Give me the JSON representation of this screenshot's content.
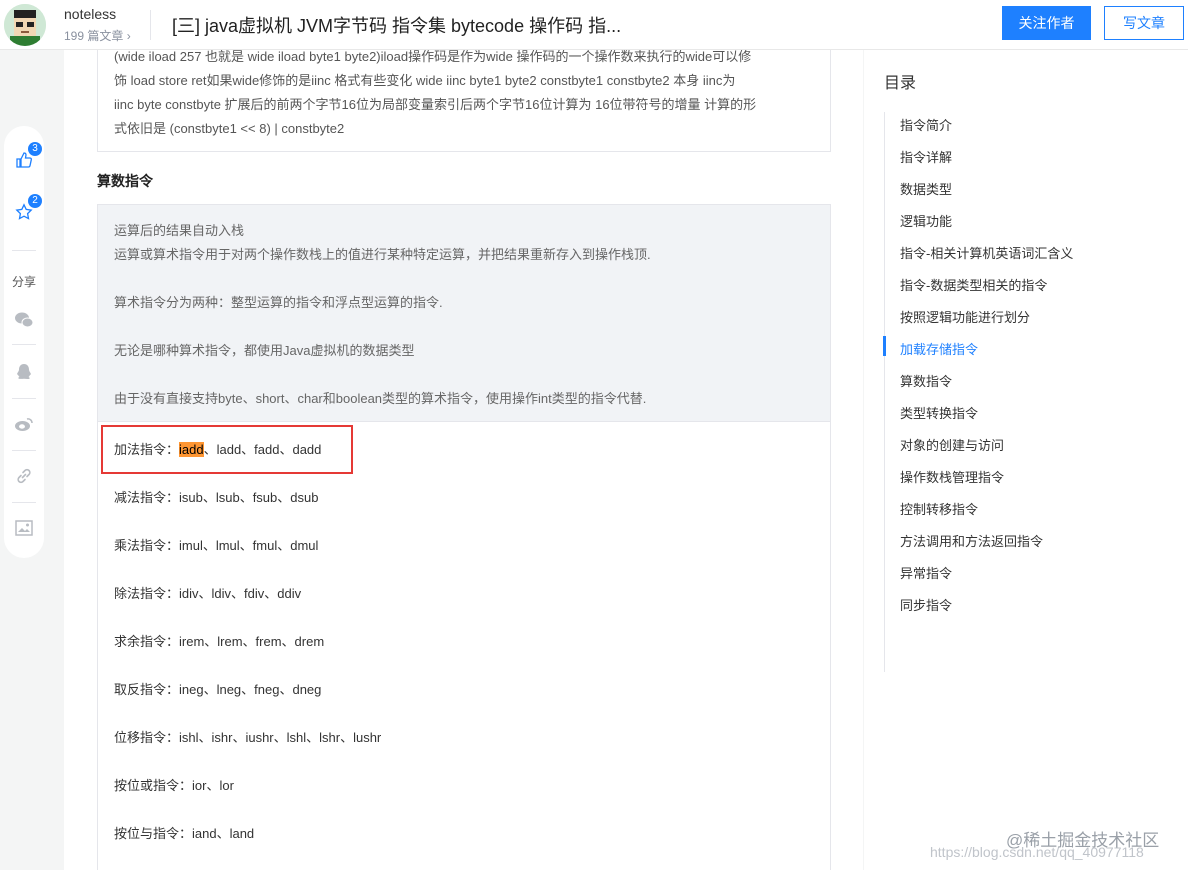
{
  "header": {
    "author_name": "noteless",
    "author_meta": "199 篇文章 ›",
    "title": "[三] java虚拟机 JVM字节码 指令集 bytecode 操作码 指...",
    "follow_label": "关注作者",
    "write_label": "写文章"
  },
  "side_actions": {
    "like_count": "3",
    "collect_count": "2",
    "share_label": "分享",
    "icons": [
      "thumbs-up-icon",
      "star-icon",
      "wechat-icon",
      "qq-icon",
      "weibo-icon",
      "link-icon",
      "image-icon"
    ]
  },
  "article": {
    "quote1_lines": [
      "(wide  iload 257 也就是  wide iload byte1 byte2)iload操作码是作为wide 操作码的一个操作数来执行的wide可以修",
      "饰 load  store  ret如果wide修饰的是iinc 格式有些变化  wide iinc  byte1 byte2 constbyte1 constbyte2  本身 iinc为",
      "iinc  byte constbyte 扩展后的前两个字节16位为局部变量索引后两个字节16位计算为 16位带符号的增量 计算的形",
      "式依旧是  (constbyte1 << 8) | constbyte2"
    ],
    "section_heading": "算数指令",
    "quote2_lines": [
      "运算后的结果自动入栈",
      "运算或算术指令用于对两个操作数栈上的值进行某种特定运算，并把结果重新存入到操作栈顶.",
      "算术指令分为两种：整型运算的指令和浮点型运算的指令.",
      "无论是哪种算术指令，都使用Java虚拟机的数据类型",
      "由于没有直接支持byte、short、char和boolean类型的算术指令，使用操作int类型的指令代替."
    ],
    "add_prefix": "加法指令：",
    "add_highlight": "iadd",
    "add_rest": "、ladd、fadd、dadd",
    "lines": [
      "减法指令：isub、lsub、fsub、dsub",
      "乘法指令：imul、lmul、fmul、dmul",
      "除法指令：idiv、ldiv、fdiv、ddiv",
      "求余指令：irem、lrem、frem、drem",
      "取反指令：ineg、lneg、fneg、dneg",
      "位移指令：ishl、ishr、iushr、lshl、lshr、lushr",
      "按位或指令：ior、lor",
      "按位与指令：iand、land"
    ]
  },
  "toc": {
    "title": "目录",
    "items": [
      "指令简介",
      "指令详解",
      "数据类型",
      "逻辑功能",
      "指令-相关计算机英语词汇含义",
      "指令-数据类型相关的指令",
      "按照逻辑功能进行划分",
      "加载存储指令",
      "算数指令",
      "类型转换指令",
      "对象的创建与访问",
      "操作数栈管理指令",
      "控制转移指令",
      "方法调用和方法返回指令",
      "异常指令",
      "同步指令"
    ],
    "active_index": 7
  },
  "watermark": {
    "site": "@稀土掘金技术社区",
    "url": "https://blog.csdn.net/qq_40977118"
  },
  "colors": {
    "accent": "#1e80ff",
    "highlight": "#ff9632",
    "red_box": "#e53935"
  }
}
